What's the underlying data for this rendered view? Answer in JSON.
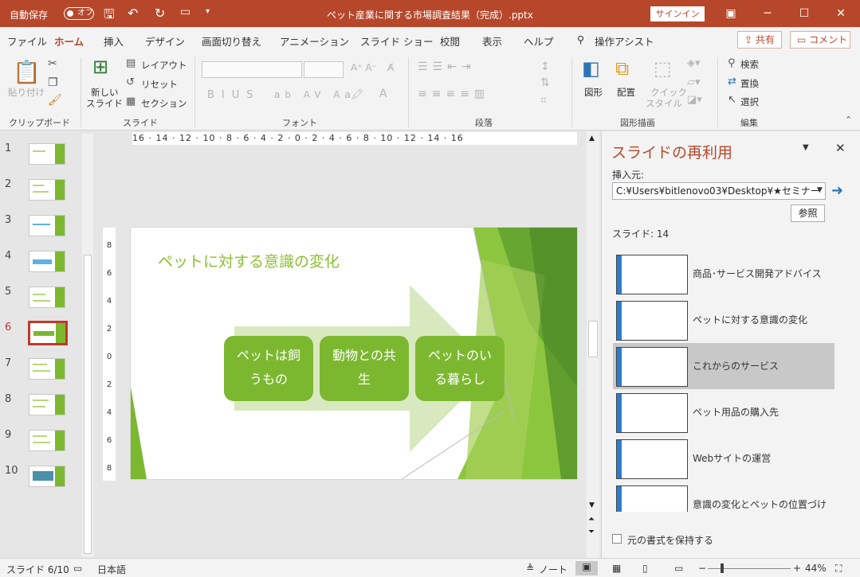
{
  "titlebar": {
    "autosave_label": "自動保存",
    "autosave_state": "オフ",
    "filename": "ペット産業に関する市場調査結果（完成）.pptx",
    "signin": "サインイン"
  },
  "menu": {
    "items": [
      "ファイル",
      "ホーム",
      "挿入",
      "デザイン",
      "画面切り替え",
      "アニメーション",
      "スライド ショー",
      "校閲",
      "表示",
      "ヘルプ"
    ],
    "tell_me": "操作アシスト",
    "share": "共有",
    "comment": "コメント"
  },
  "ribbon": {
    "clipboard": {
      "paste": "貼り付け",
      "group": "クリップボード"
    },
    "slides": {
      "new_slide_1": "新しい",
      "new_slide_2": "スライド",
      "layout": "レイアウト",
      "reset": "リセット",
      "section": "セクション",
      "group": "スライド"
    },
    "font": {
      "group": "フォント"
    },
    "paragraph": {
      "group": "段落"
    },
    "drawing": {
      "shapes": "図形",
      "arrange": "配置",
      "quick_styles_1": "クイック",
      "quick_styles_2": "スタイル",
      "group": "図形描画"
    },
    "editing": {
      "find": "検索",
      "replace": "置換",
      "select": "選択",
      "group": "編集"
    }
  },
  "thumbnails": {
    "numbers": [
      "1",
      "2",
      "3",
      "4",
      "5",
      "6",
      "7",
      "8",
      "9",
      "10"
    ],
    "current": "6"
  },
  "ruler": {
    "h": "16 · 14 · 12 · 10 · 8 · 6 · 4 · 2 · 0 · 2 · 4 · 6 · 8 · 10 · 12 · 14 · 16",
    "v": [
      "8",
      "6",
      "4",
      "2",
      "0",
      "2",
      "4",
      "6",
      "8"
    ]
  },
  "slide": {
    "title": "ペットに対する意識の変化",
    "boxes": [
      [
        "ペットは飼",
        "うもの"
      ],
      [
        "動物との共",
        "生"
      ],
      [
        "ペットのい",
        "る暮らし"
      ]
    ]
  },
  "reuse_pane": {
    "title": "スライドの再利用",
    "insert_from": "挿入元:",
    "path": "C:¥Users¥bitlenovo03¥Desktop¥★セミナー",
    "browse": "参照",
    "slide_count": "スライド: 14",
    "items": [
      "商品･サービス開発アドバイス",
      "ペットに対する意識の変化",
      "これからのサービス",
      "ペット用品の購入先",
      "Webサイトの運営",
      "意識の変化とペットの位置づけ"
    ],
    "selected_index": 2,
    "keep_format": "元の書式を保持する"
  },
  "status": {
    "slide_info": "スライド 6/10",
    "language": "日本語",
    "notes": "ノート",
    "zoom": "44%"
  },
  "colors": {
    "accent": "#b7472a",
    "green": "#7cb82f",
    "title_green": "#8cbe33"
  }
}
